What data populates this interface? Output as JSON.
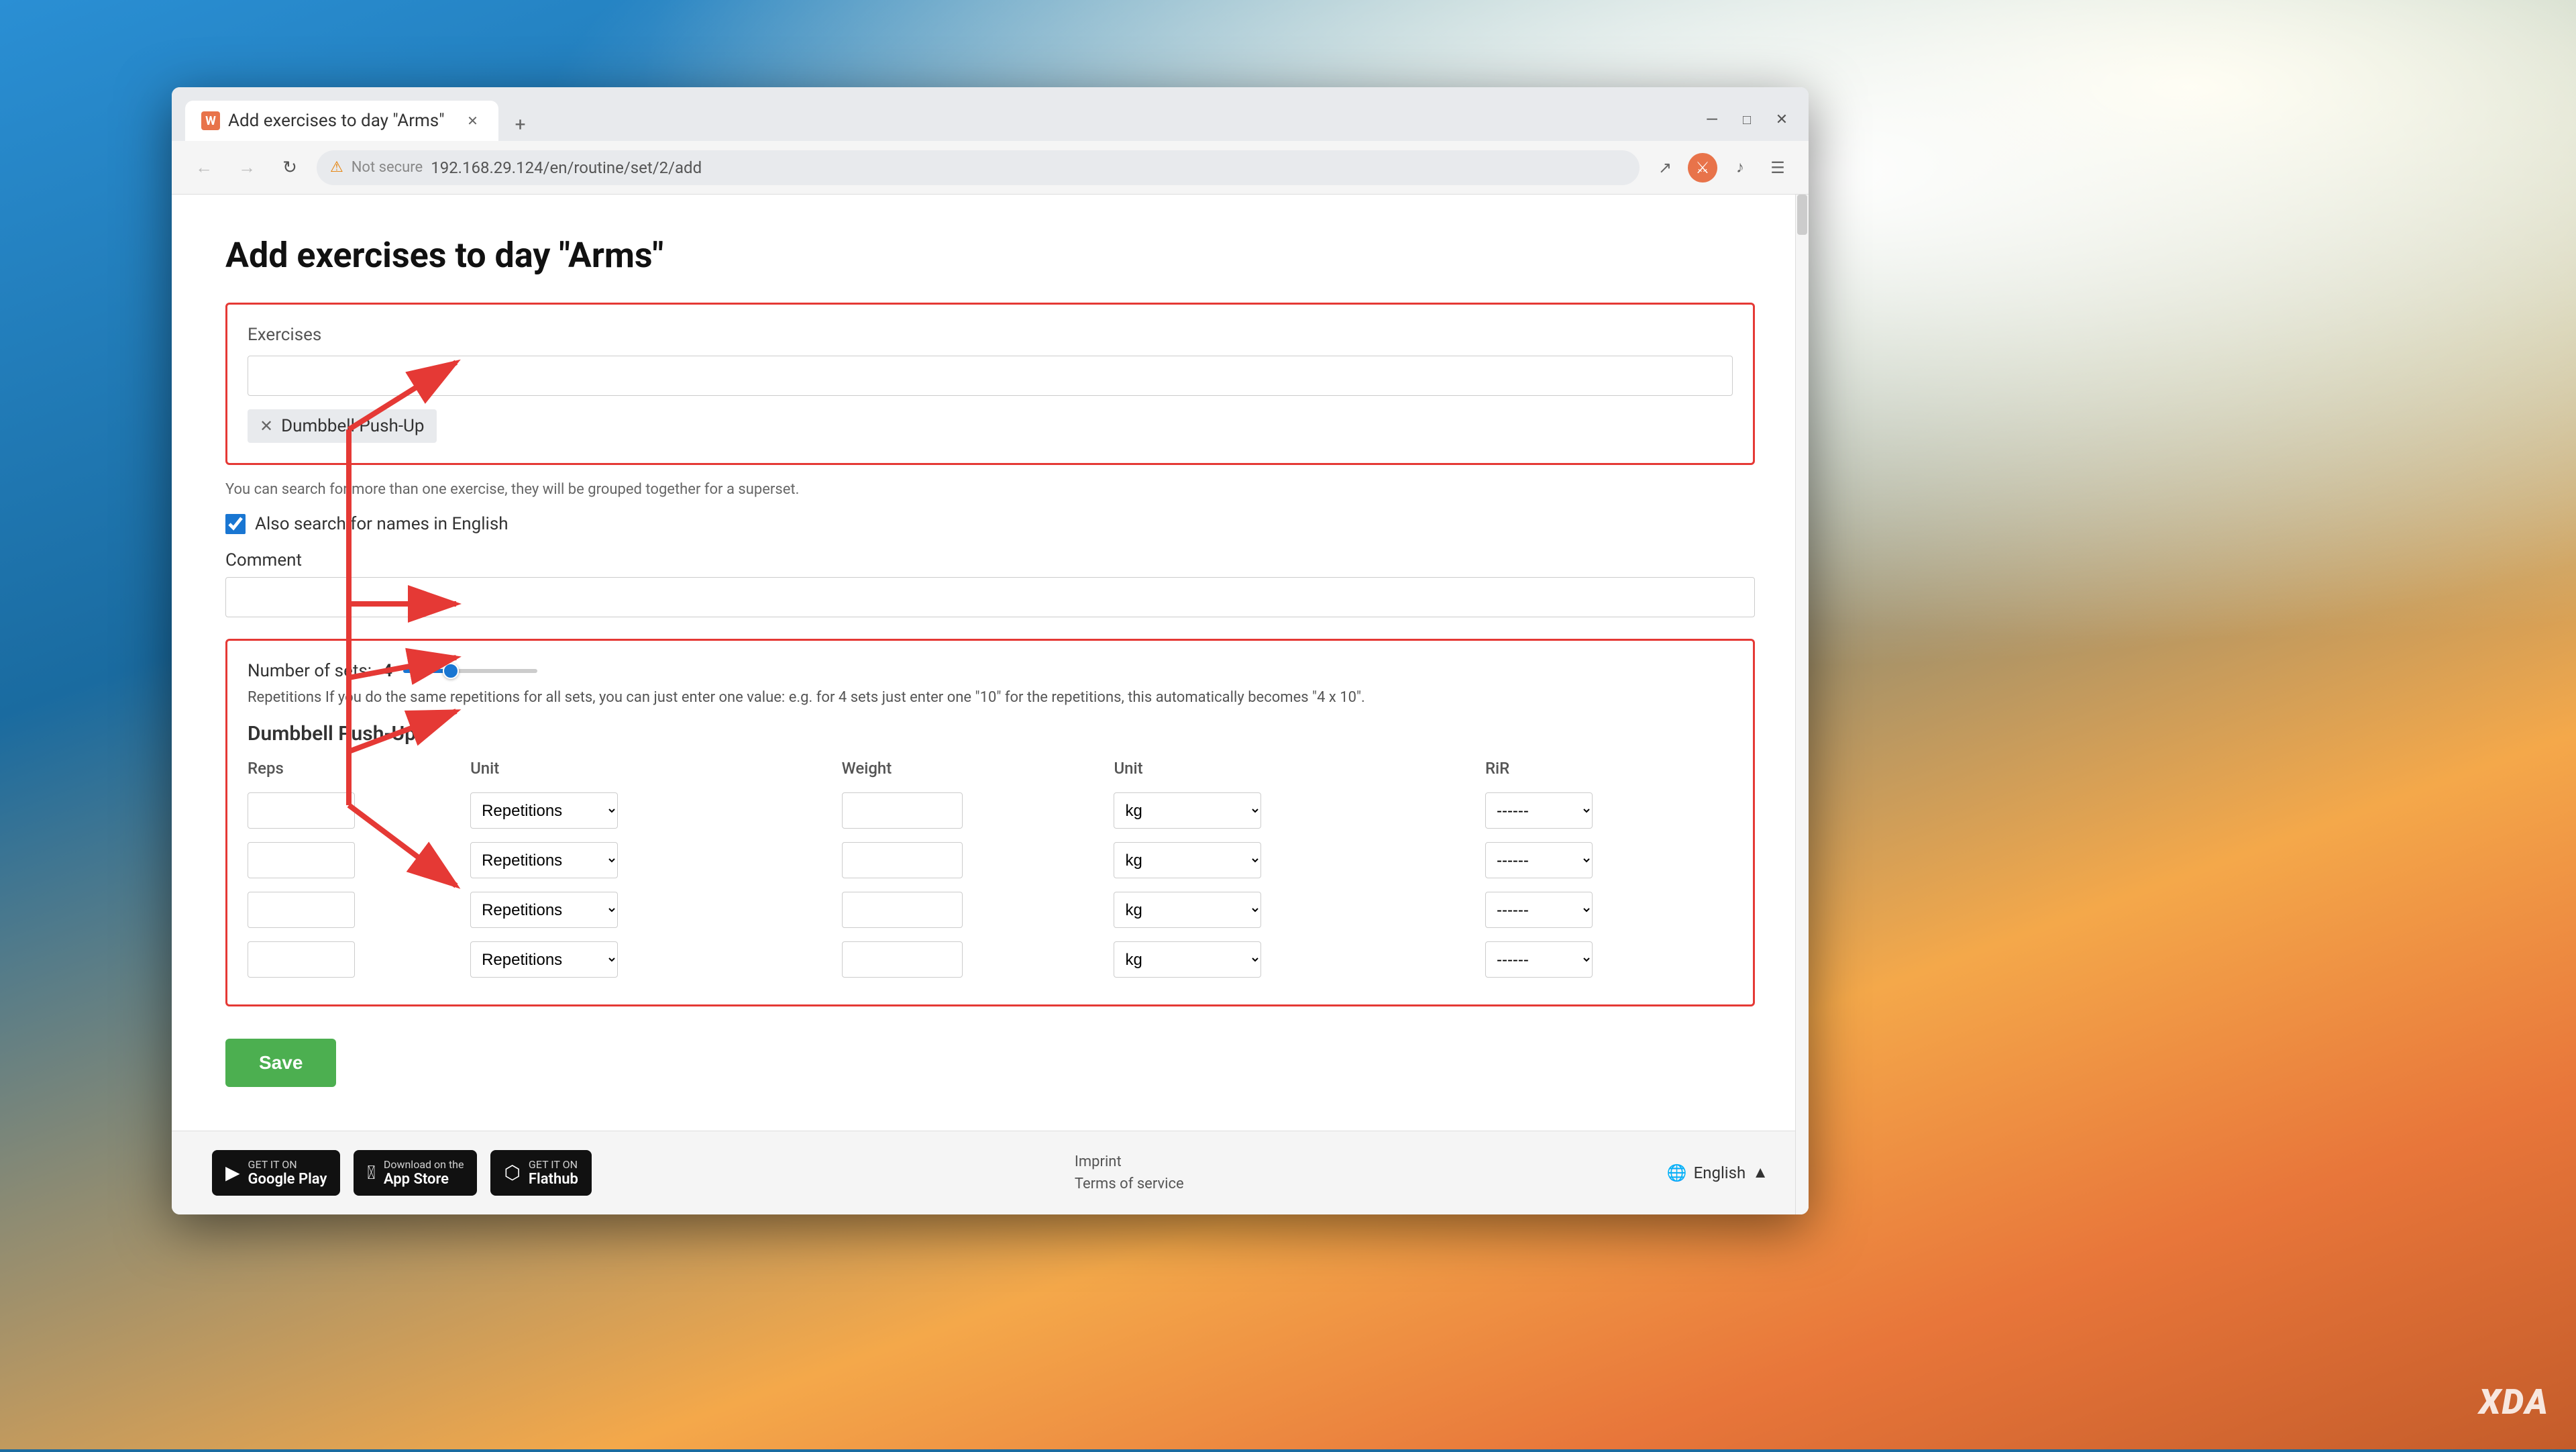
{
  "wallpaper": {
    "alt": "Anime sky background"
  },
  "browser": {
    "tab": {
      "title": "Add exercises to day \"Arms\"",
      "favicon_letter": "W"
    },
    "address_bar": {
      "url": "192.168.29.124/en/routine/set/2/add",
      "security_label": "Not secure"
    }
  },
  "page": {
    "title": "Add exercises to day \"Arms\"",
    "exercises_label": "Exercises",
    "exercise_tag": "Dumbbell Push-Up",
    "hint_text": "You can search for more than one exercise, they will be grouped together for a superset.",
    "checkbox_label": "Also search for names in English",
    "comment_label": "Comment",
    "sets_label": "Number of sets:",
    "sets_count": "4",
    "reps_hint": "Repetitions If you do the same repetitions for all sets, you can just enter one value: e.g. for 4 sets just enter one \"10\" for the repetitions, this automatically becomes \"4 x 10\".",
    "exercise_row_title": "Dumbbell Push-Up",
    "col_reps": "Reps",
    "col_unit": "Unit",
    "col_weight": "Weight",
    "col_unit2": "Unit",
    "col_rir": "RiR",
    "rows": [
      {
        "reps": "",
        "unit": "Repetitions",
        "weight": "",
        "unit2": "kg",
        "rir": "------"
      },
      {
        "reps": "",
        "unit": "Repetitions",
        "weight": "",
        "unit2": "kg",
        "rir": "------"
      },
      {
        "reps": "",
        "unit": "Repetitions",
        "weight": "",
        "unit2": "kg",
        "rir": "------"
      },
      {
        "reps": "",
        "unit": "Repetitions",
        "weight": "",
        "unit2": "kg",
        "rir": "------"
      }
    ],
    "save_button": "Save"
  },
  "footer": {
    "google_play_small": "GET IT ON",
    "google_play_big": "Google Play",
    "app_store_small": "Download on the",
    "app_store_big": "App Store",
    "flathub_small": "GET IT ON",
    "flathub_big": "Flathub",
    "imprint": "Imprint",
    "terms": "Terms of service",
    "language": "English"
  }
}
